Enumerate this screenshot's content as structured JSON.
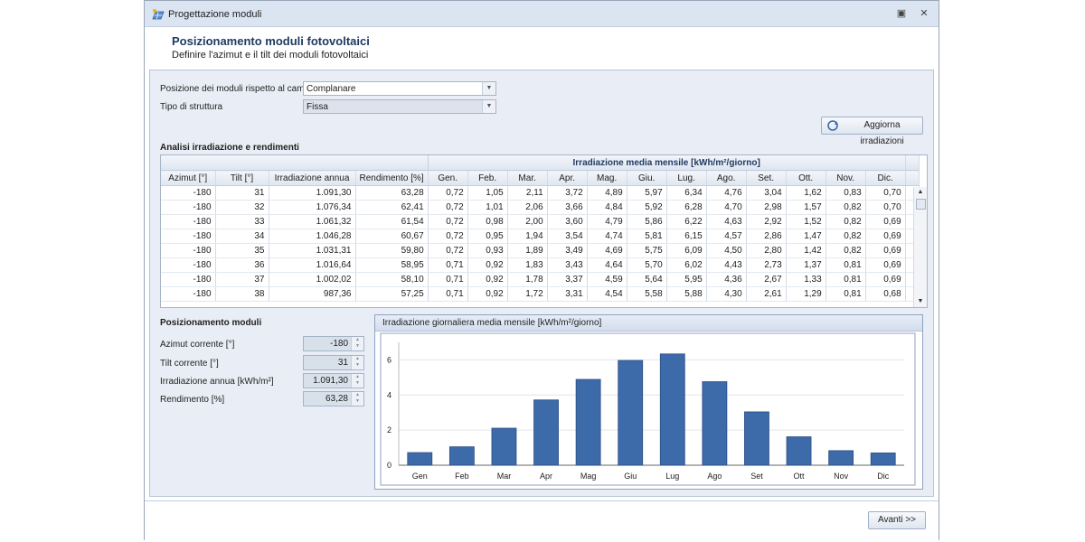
{
  "window": {
    "title": "Progettazione moduli",
    "app_icon": "solar-panel-icon"
  },
  "header": {
    "title": "Posizionamento moduli fotovoltaici",
    "subtitle": "Definire l'azimut e il tilt dei moduli fotovoltaici"
  },
  "form": {
    "posizione_label": "Posizione dei moduli rispetto al campo",
    "posizione_value": "Complanare",
    "tipo_label": "Tipo di struttura",
    "tipo_value": "Fissa",
    "refresh_button": "Aggiorna irradiazioni"
  },
  "analysis": {
    "title": "Analisi irradiazione e rendimenti",
    "group_header": "Irradiazione media mensile [kWh/m²/giorno]",
    "columns": [
      "Azimut [°]",
      "Tilt [°]",
      "Irradiazione annua",
      "Rendimento [%]",
      "Gen.",
      "Feb.",
      "Mar.",
      "Apr.",
      "Mag.",
      "Giu.",
      "Lug.",
      "Ago.",
      "Set.",
      "Ott.",
      "Nov.",
      "Dic."
    ],
    "rows": [
      [
        "-180",
        "31",
        "1.091,30",
        "63,28",
        "0,72",
        "1,05",
        "2,11",
        "3,72",
        "4,89",
        "5,97",
        "6,34",
        "4,76",
        "3,04",
        "1,62",
        "0,83",
        "0,70"
      ],
      [
        "-180",
        "32",
        "1.076,34",
        "62,41",
        "0,72",
        "1,01",
        "2,06",
        "3,66",
        "4,84",
        "5,92",
        "6,28",
        "4,70",
        "2,98",
        "1,57",
        "0,82",
        "0,70"
      ],
      [
        "-180",
        "33",
        "1.061,32",
        "61,54",
        "0,72",
        "0,98",
        "2,00",
        "3,60",
        "4,79",
        "5,86",
        "6,22",
        "4,63",
        "2,92",
        "1,52",
        "0,82",
        "0,69"
      ],
      [
        "-180",
        "34",
        "1.046,28",
        "60,67",
        "0,72",
        "0,95",
        "1,94",
        "3,54",
        "4,74",
        "5,81",
        "6,15",
        "4,57",
        "2,86",
        "1,47",
        "0,82",
        "0,69"
      ],
      [
        "-180",
        "35",
        "1.031,31",
        "59,80",
        "0,72",
        "0,93",
        "1,89",
        "3,49",
        "4,69",
        "5,75",
        "6,09",
        "4,50",
        "2,80",
        "1,42",
        "0,82",
        "0,69"
      ],
      [
        "-180",
        "36",
        "1.016,64",
        "58,95",
        "0,71",
        "0,92",
        "1,83",
        "3,43",
        "4,64",
        "5,70",
        "6,02",
        "4,43",
        "2,73",
        "1,37",
        "0,81",
        "0,69"
      ],
      [
        "-180",
        "37",
        "1.002,02",
        "58,10",
        "0,71",
        "0,92",
        "1,78",
        "3,37",
        "4,59",
        "5,64",
        "5,95",
        "4,36",
        "2,67",
        "1,33",
        "0,81",
        "0,69"
      ],
      [
        "-180",
        "38",
        "987,36",
        "57,25",
        "0,71",
        "0,92",
        "1,72",
        "3,31",
        "4,54",
        "5,58",
        "5,88",
        "4,30",
        "2,61",
        "1,29",
        "0,81",
        "0,68"
      ]
    ]
  },
  "position": {
    "title": "Posizionamento moduli",
    "fields": [
      {
        "label": "Azimut corrente [°]",
        "value": "-180"
      },
      {
        "label": "Tilt corrente [°]",
        "value": "31"
      },
      {
        "label": "Irradiazione annua [kWh/m²]",
        "value": "1.091,30"
      },
      {
        "label": "Rendimento [%]",
        "value": "63,28"
      }
    ]
  },
  "chart_caption": "Irradiazione giornaliera media mensile [kWh/m²/giorno]",
  "chart_data": {
    "type": "bar",
    "title": "",
    "xlabel": "",
    "ylabel": "",
    "categories": [
      "Gen",
      "Feb",
      "Mar",
      "Apr",
      "Mag",
      "Giu",
      "Lug",
      "Ago",
      "Set",
      "Ott",
      "Nov",
      "Dic"
    ],
    "values": [
      0.72,
      1.05,
      2.11,
      3.72,
      4.89,
      5.97,
      6.34,
      4.76,
      3.04,
      1.62,
      0.83,
      0.7
    ],
    "yticks": [
      0,
      2,
      4,
      6
    ],
    "ylim": [
      0,
      7
    ],
    "grid": true,
    "bar_color": "#3d6aa8"
  },
  "footer": {
    "next_button": "Avanti >>"
  }
}
